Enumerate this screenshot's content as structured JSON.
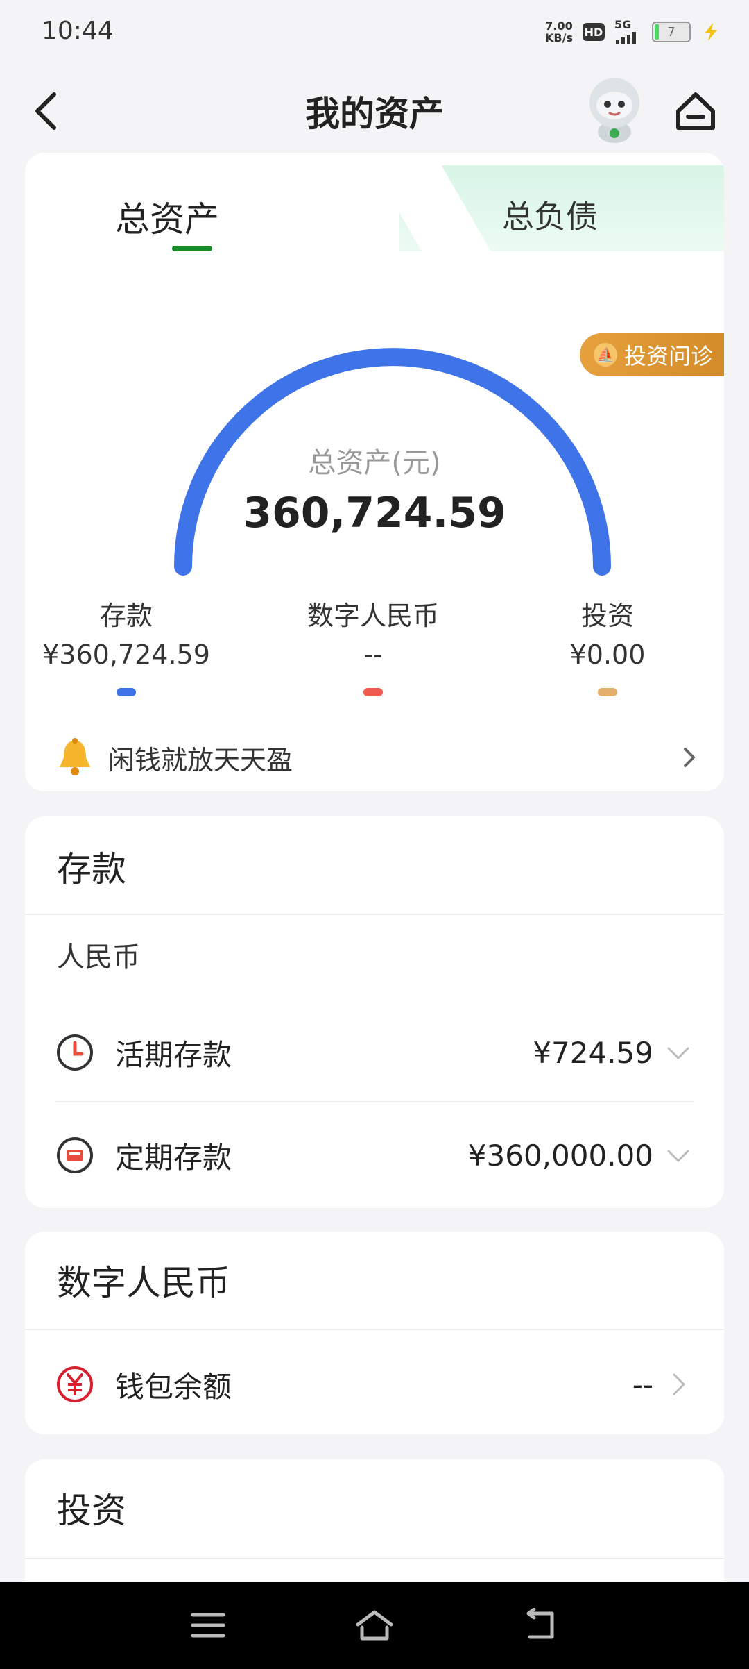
{
  "status_bar": {
    "time": "10:44",
    "net_speed_value": "7.00",
    "net_speed_unit": "KB/s",
    "hd": "HD",
    "network": "5G",
    "battery": "7"
  },
  "header": {
    "title": "我的资产"
  },
  "tabs": {
    "total_assets": "总资产",
    "total_debt": "总负债"
  },
  "gauge": {
    "label": "总资产(元)",
    "value": "360,724.59",
    "diagnosis_button": "投资问诊"
  },
  "legend": [
    {
      "name": "存款",
      "amount": "¥360,724.59",
      "color": "#3f74e8"
    },
    {
      "name": "数字人民币",
      "amount": "--",
      "color": "#ef5a4f"
    },
    {
      "name": "投资",
      "amount": "¥0.00",
      "color": "#e2b06a"
    }
  ],
  "promo": {
    "text": "闲钱就放天天盈"
  },
  "deposits": {
    "title": "存款",
    "currency": "人民币",
    "rows": [
      {
        "name": "活期存款",
        "amount": "¥724.59",
        "icon": "clock-icon"
      },
      {
        "name": "定期存款",
        "amount": "¥360,000.00",
        "icon": "calendar-icon"
      }
    ]
  },
  "digital_rmb": {
    "title": "数字人民币",
    "wallet_label": "钱包余额",
    "wallet_amount": "--"
  },
  "investment": {
    "title": "投资"
  },
  "colors": {
    "primary_blue": "#3f74e8",
    "tab_green": "#1a8a2a",
    "diagnosis_orange": "#d08a27",
    "yuan_red": "#d6202e"
  }
}
